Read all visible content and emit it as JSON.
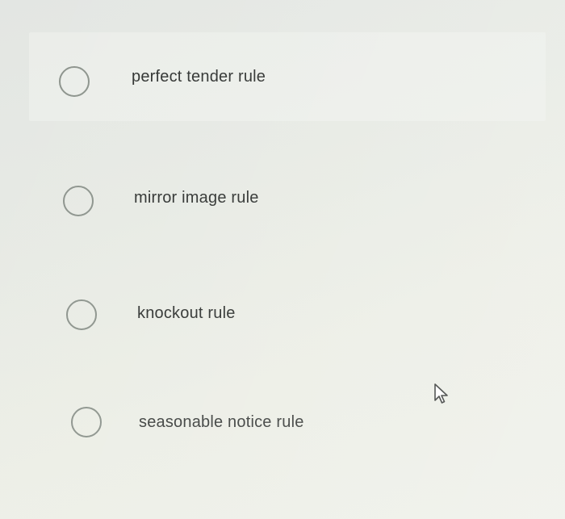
{
  "question": {
    "options": [
      {
        "label": "perfect tender rule",
        "selected": false
      },
      {
        "label": "mirror image rule",
        "selected": false
      },
      {
        "label": "knockout rule",
        "selected": false
      },
      {
        "label": "seasonable notice rule",
        "selected": false
      }
    ]
  },
  "cursor": {
    "icon": "arrow-pointer-icon"
  }
}
